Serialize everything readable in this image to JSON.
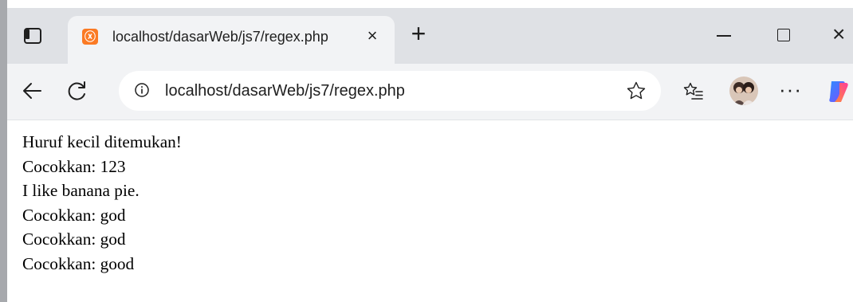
{
  "browser": {
    "tab": {
      "title": "localhost/dasarWeb/js7/regex.php",
      "close_glyph": "×",
      "favicon_glyph": "ⓧ",
      "favicon_icon": "xampp-icon",
      "favicon_color": "#fb7a24"
    },
    "new_tab_glyph": "+",
    "window": {
      "close_glyph": "×"
    },
    "address": {
      "url": "localhost/dasarWeb/js7/regex.php"
    },
    "toolbar": {
      "more_glyph": "···"
    }
  },
  "page": {
    "lines": [
      "Huruf kecil ditemukan!",
      "Cocokkan: 123",
      "I like banana pie.",
      "Cocokkan: god",
      "Cocokkan: god",
      "Cocokkan: good"
    ]
  }
}
